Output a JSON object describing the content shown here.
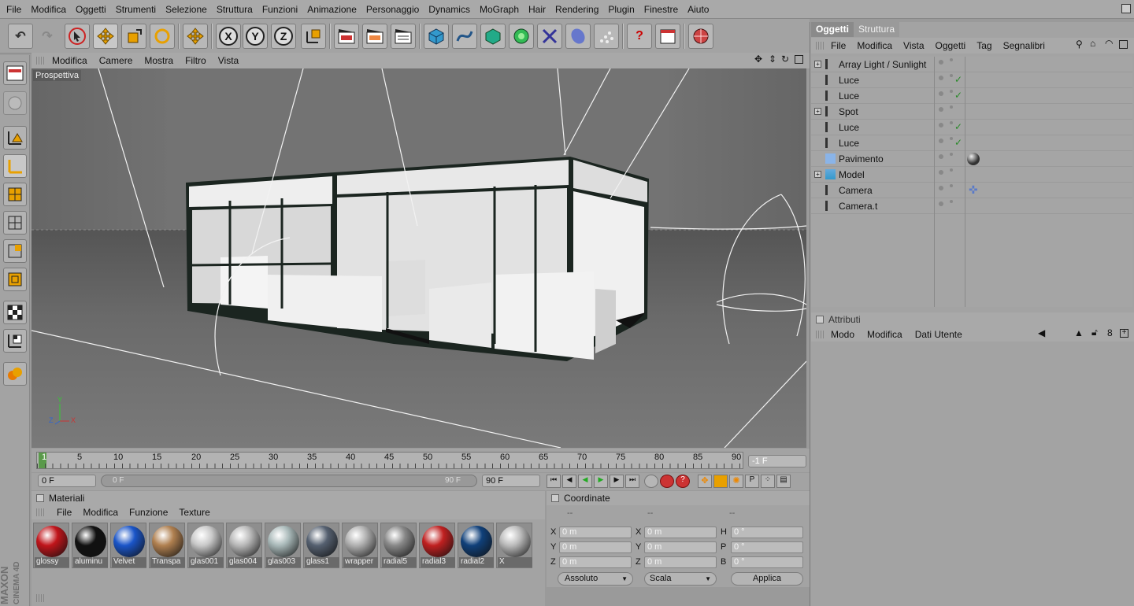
{
  "menubar": [
    "File",
    "Modifica",
    "Oggetti",
    "Strumenti",
    "Selezione",
    "Struttura",
    "Funzioni",
    "Animazione",
    "Personaggio",
    "Dynamics",
    "MoGraph",
    "Hair",
    "Rendering",
    "Plugin",
    "Finestre",
    "Aiuto"
  ],
  "viewport": {
    "menu": [
      "Modifica",
      "Camere",
      "Mostra",
      "Filtro",
      "Vista"
    ],
    "label": "Prospettiva",
    "axes": {
      "x": "X",
      "y": "Y",
      "z": "Z"
    }
  },
  "timeline": {
    "ticks": [
      "1",
      "5",
      "10",
      "15",
      "20",
      "25",
      "30",
      "35",
      "40",
      "45",
      "50",
      "55",
      "60",
      "65",
      "70",
      "75",
      "80",
      "85",
      "90"
    ],
    "current_frame": "-1 F",
    "start": "0 F",
    "slider_start": "0 F",
    "slider_end": "90 F",
    "end": "90 F"
  },
  "materials": {
    "title": "Materiali",
    "menu": [
      "File",
      "Modifica",
      "Funzione",
      "Texture"
    ],
    "items": [
      {
        "name": "glossy",
        "color": "#c0141a"
      },
      {
        "name": "aluminu",
        "color": "#111111"
      },
      {
        "name": "Velvet",
        "color": "#1a55c8"
      },
      {
        "name": "Transpa",
        "color": "#b08050"
      },
      {
        "name": "glas001",
        "color": "#c8c8c8"
      },
      {
        "name": "glas004",
        "color": "#b8b8b8"
      },
      {
        "name": "glas003",
        "color": "#a8b8b8"
      },
      {
        "name": "glass1",
        "color": "#556070"
      },
      {
        "name": "wrapper",
        "color": "#b0b0b0"
      },
      {
        "name": "radial5",
        "color": "#888888"
      },
      {
        "name": "radial3",
        "color": "#c02020"
      },
      {
        "name": "radial2",
        "color": "#10407a"
      },
      {
        "name": "X",
        "color": "#bbbbbb"
      }
    ]
  },
  "coordinates": {
    "title": "Coordinate",
    "rows": [
      {
        "l1": "X",
        "v1": "0 m",
        "l2": "X",
        "v2": "0 m",
        "l3": "H",
        "v3": "0 °"
      },
      {
        "l1": "Y",
        "v1": "0 m",
        "l2": "Y",
        "v2": "0 m",
        "l3": "P",
        "v3": "0 °"
      },
      {
        "l1": "Z",
        "v1": "0 m",
        "l2": "Z",
        "v2": "0 m",
        "l3": "B",
        "v3": "0 °"
      }
    ],
    "mode": "Assoluto",
    "scale": "Scala",
    "apply": "Applica"
  },
  "objects": {
    "tabs": [
      "Oggetti",
      "Struttura"
    ],
    "menu": [
      "File",
      "Modifica",
      "Vista",
      "Oggetti",
      "Tag",
      "Segnalibri"
    ],
    "items": [
      {
        "name": "Array Light / Sunlight",
        "expand": true,
        "check": false
      },
      {
        "name": "Luce",
        "expand": false,
        "check": true
      },
      {
        "name": "Luce",
        "expand": false,
        "check": true
      },
      {
        "name": "Spot",
        "expand": true,
        "check": false
      },
      {
        "name": "Luce",
        "expand": false,
        "check": true
      },
      {
        "name": "Luce",
        "expand": false,
        "check": true
      },
      {
        "name": "Pavimento",
        "expand": false,
        "check": false
      },
      {
        "name": "Model",
        "expand": true,
        "check": false
      },
      {
        "name": "Camera",
        "expand": false,
        "check": false
      },
      {
        "name": "Camera.t",
        "expand": false,
        "check": false
      }
    ]
  },
  "attributes": {
    "title": "Attributi",
    "menu": [
      "Modo",
      "Modifica",
      "Dati Utente"
    ]
  },
  "brand": "MAXON CINEMA 4D"
}
